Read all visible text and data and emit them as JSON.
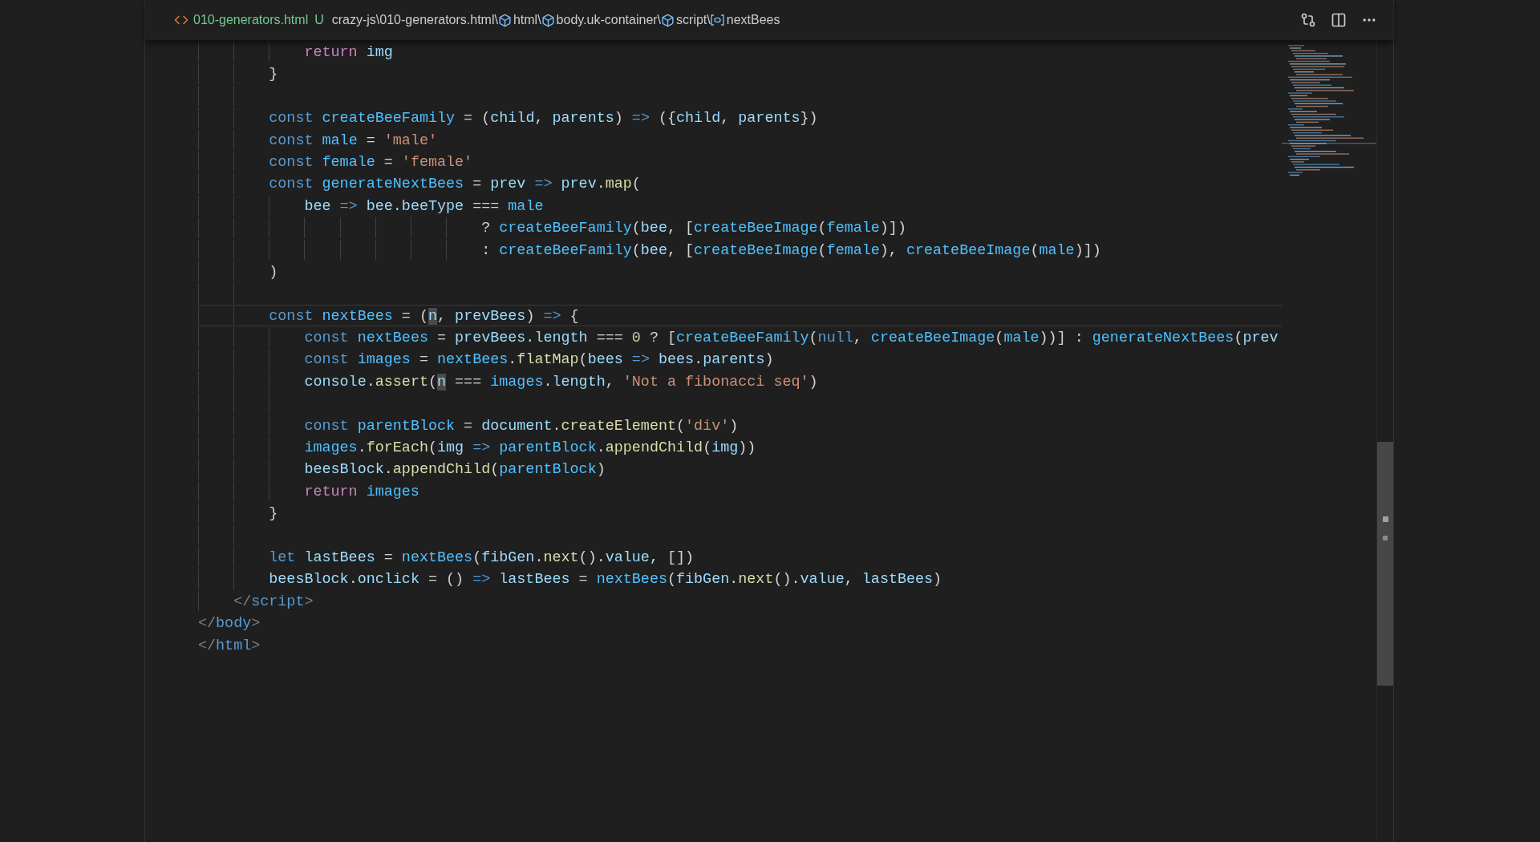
{
  "header": {
    "file": {
      "name": "010-generators.html",
      "status": "U"
    },
    "breadcrumbs": [
      {
        "kind": "path",
        "text": "crazy-js\\010-generators.html\\"
      },
      {
        "kind": "element",
        "text": "html\\"
      },
      {
        "kind": "element",
        "text": "body.uk-container\\"
      },
      {
        "kind": "element",
        "text": "script\\"
      },
      {
        "kind": "variable",
        "text": "nextBees"
      }
    ]
  },
  "lines": [
    {
      "current": false,
      "tokens": [
        {
          "text": "            return",
          "kind": "ctrl"
        },
        {
          "text": " img",
          "kind": "var"
        }
      ]
    },
    {
      "current": false,
      "tokens": [
        {
          "text": "        }",
          "kind": "p"
        }
      ]
    },
    {
      "current": false
    },
    {
      "current": false,
      "tokens": [
        {
          "text": "        const",
          "kind": "kw"
        },
        {
          "text": " createBeeFamily",
          "kind": "const"
        },
        {
          "text": " = (",
          "kind": "p"
        },
        {
          "text": "child",
          "kind": "var"
        },
        {
          "text": ", ",
          "kind": "p"
        },
        {
          "text": "parents",
          "kind": "var"
        },
        {
          "text": ") ",
          "kind": "p"
        },
        {
          "text": "=>",
          "kind": "kw"
        },
        {
          "text": " ({",
          "kind": "p"
        },
        {
          "text": "child",
          "kind": "var"
        },
        {
          "text": ", ",
          "kind": "p"
        },
        {
          "text": "parents",
          "kind": "var"
        },
        {
          "text": "})",
          "kind": "p"
        }
      ]
    },
    {
      "current": false,
      "tokens": [
        {
          "text": "        const",
          "kind": "kw"
        },
        {
          "text": " male",
          "kind": "const"
        },
        {
          "text": " = ",
          "kind": "p"
        },
        {
          "text": "'male'",
          "kind": "str"
        }
      ]
    },
    {
      "current": false,
      "tokens": [
        {
          "text": "        const",
          "kind": "kw"
        },
        {
          "text": " female",
          "kind": "const"
        },
        {
          "text": " = ",
          "kind": "p"
        },
        {
          "text": "'female'",
          "kind": "str"
        }
      ]
    },
    {
      "current": false,
      "tokens": [
        {
          "text": "        const",
          "kind": "kw"
        },
        {
          "text": " generateNextBees",
          "kind": "const"
        },
        {
          "text": " = ",
          "kind": "p"
        },
        {
          "text": "prev",
          "kind": "var"
        },
        {
          "text": " => ",
          "kind": "kw"
        },
        {
          "text": "prev",
          "kind": "var"
        },
        {
          "text": ".",
          "kind": "p"
        },
        {
          "text": "map",
          "kind": "fn"
        },
        {
          "text": "(",
          "kind": "p"
        }
      ]
    },
    {
      "current": false,
      "tokens": [
        {
          "text": "            bee",
          "kind": "var"
        },
        {
          "text": " => ",
          "kind": "kw"
        },
        {
          "text": "bee",
          "kind": "var"
        },
        {
          "text": ".",
          "kind": "p"
        },
        {
          "text": "beeType",
          "kind": "var"
        },
        {
          "text": " === ",
          "kind": "p"
        },
        {
          "text": "male",
          "kind": "const"
        }
      ]
    },
    {
      "current": false,
      "tokens": [
        {
          "text": "                                ? ",
          "kind": "p"
        },
        {
          "text": "createBeeFamily",
          "kind": "const"
        },
        {
          "text": "(",
          "kind": "p"
        },
        {
          "text": "bee",
          "kind": "var"
        },
        {
          "text": ", [",
          "kind": "p"
        },
        {
          "text": "createBeeImage",
          "kind": "const"
        },
        {
          "text": "(",
          "kind": "p"
        },
        {
          "text": "female",
          "kind": "const"
        },
        {
          "text": ")])",
          "kind": "p"
        }
      ]
    },
    {
      "current": false,
      "tokens": [
        {
          "text": "                                : ",
          "kind": "p"
        },
        {
          "text": "createBeeFamily",
          "kind": "const"
        },
        {
          "text": "(",
          "kind": "p"
        },
        {
          "text": "bee",
          "kind": "var"
        },
        {
          "text": ", [",
          "kind": "p"
        },
        {
          "text": "createBeeImage",
          "kind": "const"
        },
        {
          "text": "(",
          "kind": "p"
        },
        {
          "text": "female",
          "kind": "const"
        },
        {
          "text": "), ",
          "kind": "p"
        },
        {
          "text": "createBeeImage",
          "kind": "const"
        },
        {
          "text": "(",
          "kind": "p"
        },
        {
          "text": "male",
          "kind": "const"
        },
        {
          "text": ")])",
          "kind": "p"
        }
      ]
    },
    {
      "current": false,
      "tokens": [
        {
          "text": "        )",
          "kind": "p"
        }
      ]
    },
    {
      "current": false
    },
    {
      "current": true,
      "tokens": [
        {
          "text": "        const",
          "kind": "kw"
        },
        {
          "text": " nextBees",
          "kind": "const"
        },
        {
          "text": " = (",
          "kind": "p"
        },
        {
          "text": "n",
          "kind": "hl"
        },
        {
          "text": ", ",
          "kind": "p"
        },
        {
          "text": "prevBees",
          "kind": "var"
        },
        {
          "text": ") ",
          "kind": "p"
        },
        {
          "text": "=>",
          "kind": "kw"
        },
        {
          "text": " {",
          "kind": "p"
        }
      ]
    },
    {
      "current": false,
      "tokens": [
        {
          "text": "            const",
          "kind": "kw"
        },
        {
          "text": " nextBees",
          "kind": "const"
        },
        {
          "text": " = ",
          "kind": "p"
        },
        {
          "text": "prevBees",
          "kind": "var"
        },
        {
          "text": ".",
          "kind": "p"
        },
        {
          "text": "length",
          "kind": "var"
        },
        {
          "text": " === ",
          "kind": "p"
        },
        {
          "text": "0",
          "kind": "num"
        },
        {
          "text": " ? [",
          "kind": "p"
        },
        {
          "text": "createBeeFamily",
          "kind": "const"
        },
        {
          "text": "(",
          "kind": "p"
        },
        {
          "text": "null",
          "kind": "kw"
        },
        {
          "text": ", ",
          "kind": "p"
        },
        {
          "text": "createBeeImage",
          "kind": "const"
        },
        {
          "text": "(",
          "kind": "p"
        },
        {
          "text": "male",
          "kind": "const"
        },
        {
          "text": "))] : ",
          "kind": "p"
        },
        {
          "text": "generateNextBees",
          "kind": "const"
        },
        {
          "text": "(",
          "kind": "p"
        },
        {
          "text": "prev",
          "kind": "var"
        }
      ]
    },
    {
      "current": false,
      "tokens": [
        {
          "text": "            const",
          "kind": "kw"
        },
        {
          "text": " images",
          "kind": "const"
        },
        {
          "text": " = ",
          "kind": "p"
        },
        {
          "text": "nextBees",
          "kind": "const"
        },
        {
          "text": ".",
          "kind": "p"
        },
        {
          "text": "flatMap",
          "kind": "fn"
        },
        {
          "text": "(",
          "kind": "p"
        },
        {
          "text": "bees",
          "kind": "var"
        },
        {
          "text": " => ",
          "kind": "kw"
        },
        {
          "text": "bees",
          "kind": "var"
        },
        {
          "text": ".",
          "kind": "p"
        },
        {
          "text": "parents",
          "kind": "var"
        },
        {
          "text": ")",
          "kind": "p"
        }
      ]
    },
    {
      "current": false,
      "tokens": [
        {
          "text": "            console",
          "kind": "var"
        },
        {
          "text": ".",
          "kind": "p"
        },
        {
          "text": "assert",
          "kind": "fn"
        },
        {
          "text": "(",
          "kind": "p"
        },
        {
          "text": "n",
          "kind": "hl"
        },
        {
          "text": " === ",
          "kind": "p"
        },
        {
          "text": "images",
          "kind": "const"
        },
        {
          "text": ".",
          "kind": "p"
        },
        {
          "text": "length",
          "kind": "var"
        },
        {
          "text": ", ",
          "kind": "p"
        },
        {
          "text": "'Not a fibonacci seq'",
          "kind": "str"
        },
        {
          "text": ")",
          "kind": "p"
        }
      ]
    },
    {
      "current": false
    },
    {
      "current": false,
      "tokens": [
        {
          "text": "            const",
          "kind": "kw"
        },
        {
          "text": " parentBlock",
          "kind": "const"
        },
        {
          "text": " = ",
          "kind": "p"
        },
        {
          "text": "document",
          "kind": "var"
        },
        {
          "text": ".",
          "kind": "p"
        },
        {
          "text": "createElement",
          "kind": "fn"
        },
        {
          "text": "(",
          "kind": "p"
        },
        {
          "text": "'div'",
          "kind": "str"
        },
        {
          "text": ")",
          "kind": "p"
        }
      ]
    },
    {
      "current": false,
      "tokens": [
        {
          "text": "            images",
          "kind": "const"
        },
        {
          "text": ".",
          "kind": "p"
        },
        {
          "text": "forEach",
          "kind": "fn"
        },
        {
          "text": "(",
          "kind": "p"
        },
        {
          "text": "img",
          "kind": "var"
        },
        {
          "text": " => ",
          "kind": "kw"
        },
        {
          "text": "parentBlock",
          "kind": "const"
        },
        {
          "text": ".",
          "kind": "p"
        },
        {
          "text": "appendChild",
          "kind": "fn"
        },
        {
          "text": "(",
          "kind": "p"
        },
        {
          "text": "img",
          "kind": "var"
        },
        {
          "text": "))",
          "kind": "p"
        }
      ]
    },
    {
      "current": false,
      "tokens": [
        {
          "text": "            beesBlock",
          "kind": "var"
        },
        {
          "text": ".",
          "kind": "p"
        },
        {
          "text": "appendChild",
          "kind": "fn"
        },
        {
          "text": "(",
          "kind": "p"
        },
        {
          "text": "parentBlock",
          "kind": "const"
        },
        {
          "text": ")",
          "kind": "p"
        }
      ]
    },
    {
      "current": false,
      "tokens": [
        {
          "text": "            return",
          "kind": "ctrl"
        },
        {
          "text": " images",
          "kind": "const"
        }
      ]
    },
    {
      "current": false,
      "tokens": [
        {
          "text": "        }",
          "kind": "p"
        }
      ]
    },
    {
      "current": false
    },
    {
      "current": false,
      "tokens": [
        {
          "text": "        let",
          "kind": "kw"
        },
        {
          "text": " lastBees",
          "kind": "var"
        },
        {
          "text": " = ",
          "kind": "p"
        },
        {
          "text": "nextBees",
          "kind": "const"
        },
        {
          "text": "(",
          "kind": "p"
        },
        {
          "text": "fibGen",
          "kind": "var"
        },
        {
          "text": ".",
          "kind": "p"
        },
        {
          "text": "next",
          "kind": "fn"
        },
        {
          "text": "().",
          "kind": "p"
        },
        {
          "text": "value",
          "kind": "var"
        },
        {
          "text": ", [])",
          "kind": "p"
        }
      ]
    },
    {
      "current": false,
      "tokens": [
        {
          "text": "        beesBlock",
          "kind": "var"
        },
        {
          "text": ".",
          "kind": "p"
        },
        {
          "text": "onclick",
          "kind": "var"
        },
        {
          "text": " = () ",
          "kind": "p"
        },
        {
          "text": "=> ",
          "kind": "kw"
        },
        {
          "text": "lastBees",
          "kind": "var"
        },
        {
          "text": " = ",
          "kind": "p"
        },
        {
          "text": "nextBees",
          "kind": "const"
        },
        {
          "text": "(",
          "kind": "p"
        },
        {
          "text": "fibGen",
          "kind": "var"
        },
        {
          "text": ".",
          "kind": "p"
        },
        {
          "text": "next",
          "kind": "fn"
        },
        {
          "text": "().",
          "kind": "p"
        },
        {
          "text": "value",
          "kind": "var"
        },
        {
          "text": ", ",
          "kind": "p"
        },
        {
          "text": "lastBees",
          "kind": "var"
        },
        {
          "text": ")",
          "kind": "p"
        }
      ]
    },
    {
      "current": false,
      "tokens": [
        {
          "text": "    </",
          "kind": "tag"
        },
        {
          "text": "script",
          "kind": "tagname"
        },
        {
          "text": ">",
          "kind": "tag"
        }
      ]
    },
    {
      "current": false,
      "tokens": [
        {
          "text": "</",
          "kind": "tag"
        },
        {
          "text": "body",
          "kind": "tagname"
        },
        {
          "text": ">",
          "kind": "tag"
        }
      ]
    },
    {
      "current": false,
      "tokens": [
        {
          "text": "</",
          "kind": "tag"
        },
        {
          "text": "html",
          "kind": "tagname"
        },
        {
          "text": ">",
          "kind": "tag"
        }
      ]
    }
  ]
}
